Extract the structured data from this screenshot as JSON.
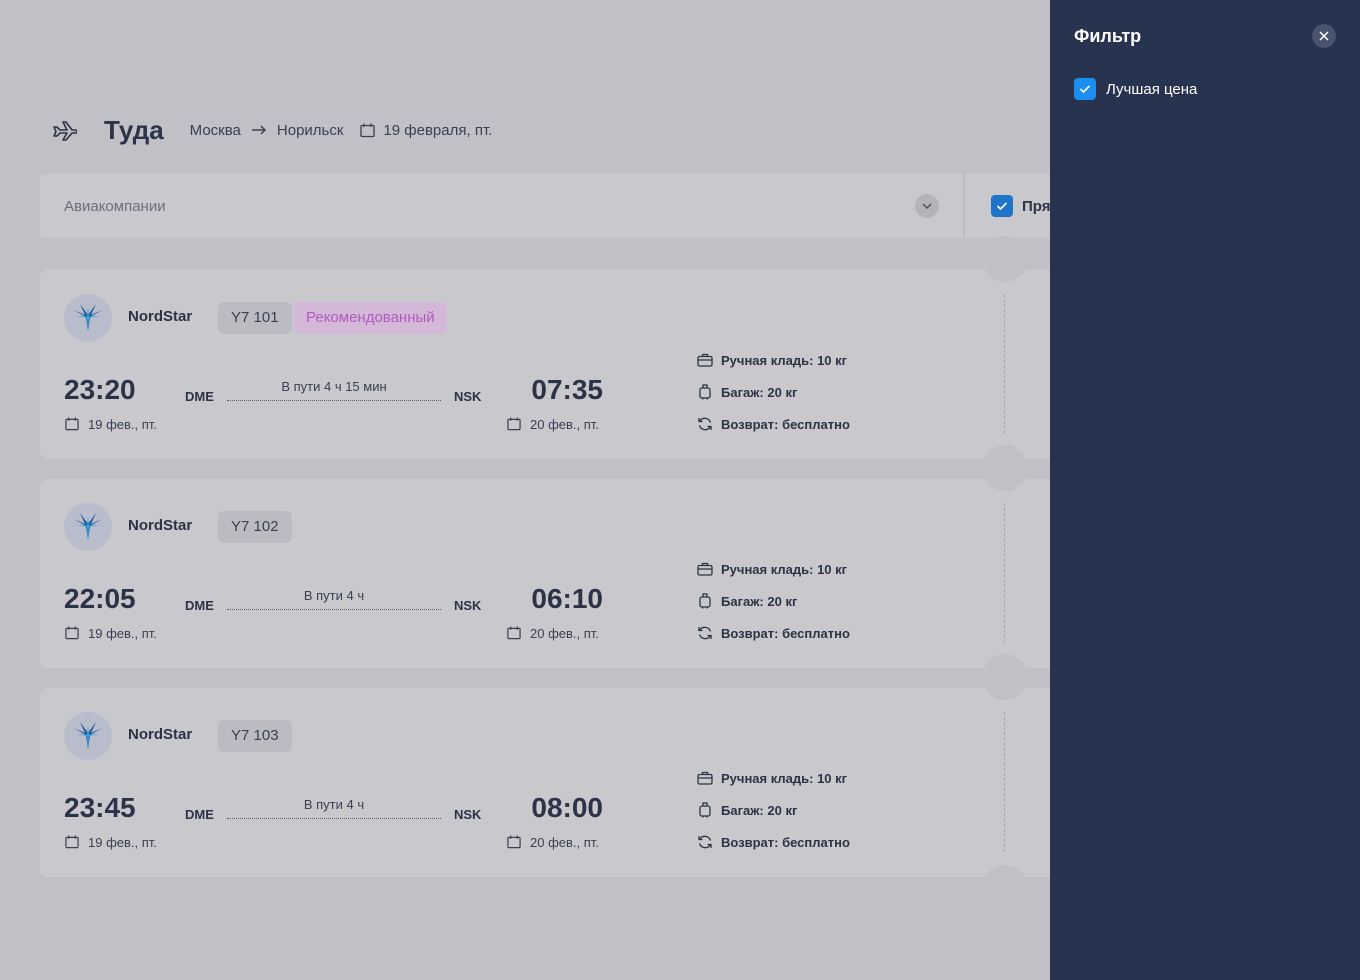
{
  "header": {
    "title": "Туда",
    "from": "Москва",
    "to": "Норильск",
    "date": "19 февраля, пт."
  },
  "filterbar": {
    "airlines_placeholder": "Авиакомпании",
    "direct_label": "Пря",
    "direct_checked": true
  },
  "flights": [
    {
      "airline": "NordStar",
      "flight_no": "Y7 101",
      "badge": "Рекомендованный",
      "dep_time": "23:20",
      "dep_code": "DME",
      "duration": "В пути 4 ч 15 мин",
      "arr_code": "NSK",
      "arr_time": "07:35",
      "dep_date": "19 фев., пт.",
      "arr_date": "20 фев., пт.",
      "hand_luggage": "Ручная кладь: 10 кг",
      "baggage": "Багаж: 20 кг",
      "refund": "Возврат: бесплатно"
    },
    {
      "airline": "NordStar",
      "flight_no": "Y7 102",
      "dep_time": "22:05",
      "dep_code": "DME",
      "duration": "В пути 4 ч",
      "arr_code": "NSK",
      "arr_time": "06:10",
      "dep_date": "19 фев., пт.",
      "arr_date": "20 фев., пт.",
      "hand_luggage": "Ручная кладь: 10 кг",
      "baggage": "Багаж: 20 кг",
      "refund": "Возврат: бесплатно"
    },
    {
      "airline": "NordStar",
      "flight_no": "Y7 103",
      "dep_time": "23:45",
      "dep_code": "DME",
      "duration": "В пути 4 ч",
      "arr_code": "NSK",
      "arr_time": "08:00",
      "dep_date": "19 фев., пт.",
      "arr_date": "20 фев., пт.",
      "hand_luggage": "Ручная кладь: 10 кг",
      "baggage": "Багаж: 20 кг",
      "refund": "Возврат: бесплатно"
    }
  ],
  "filter_panel": {
    "title": "Фильтр",
    "best_price_label": "Лучшая цена",
    "best_price_checked": true
  },
  "colors": {
    "overlay_bg": "#c1c0c6",
    "panel_bg": "#28334f",
    "checkbox_blue": "#1b8ef1",
    "badge_text": "#b35ac0"
  }
}
